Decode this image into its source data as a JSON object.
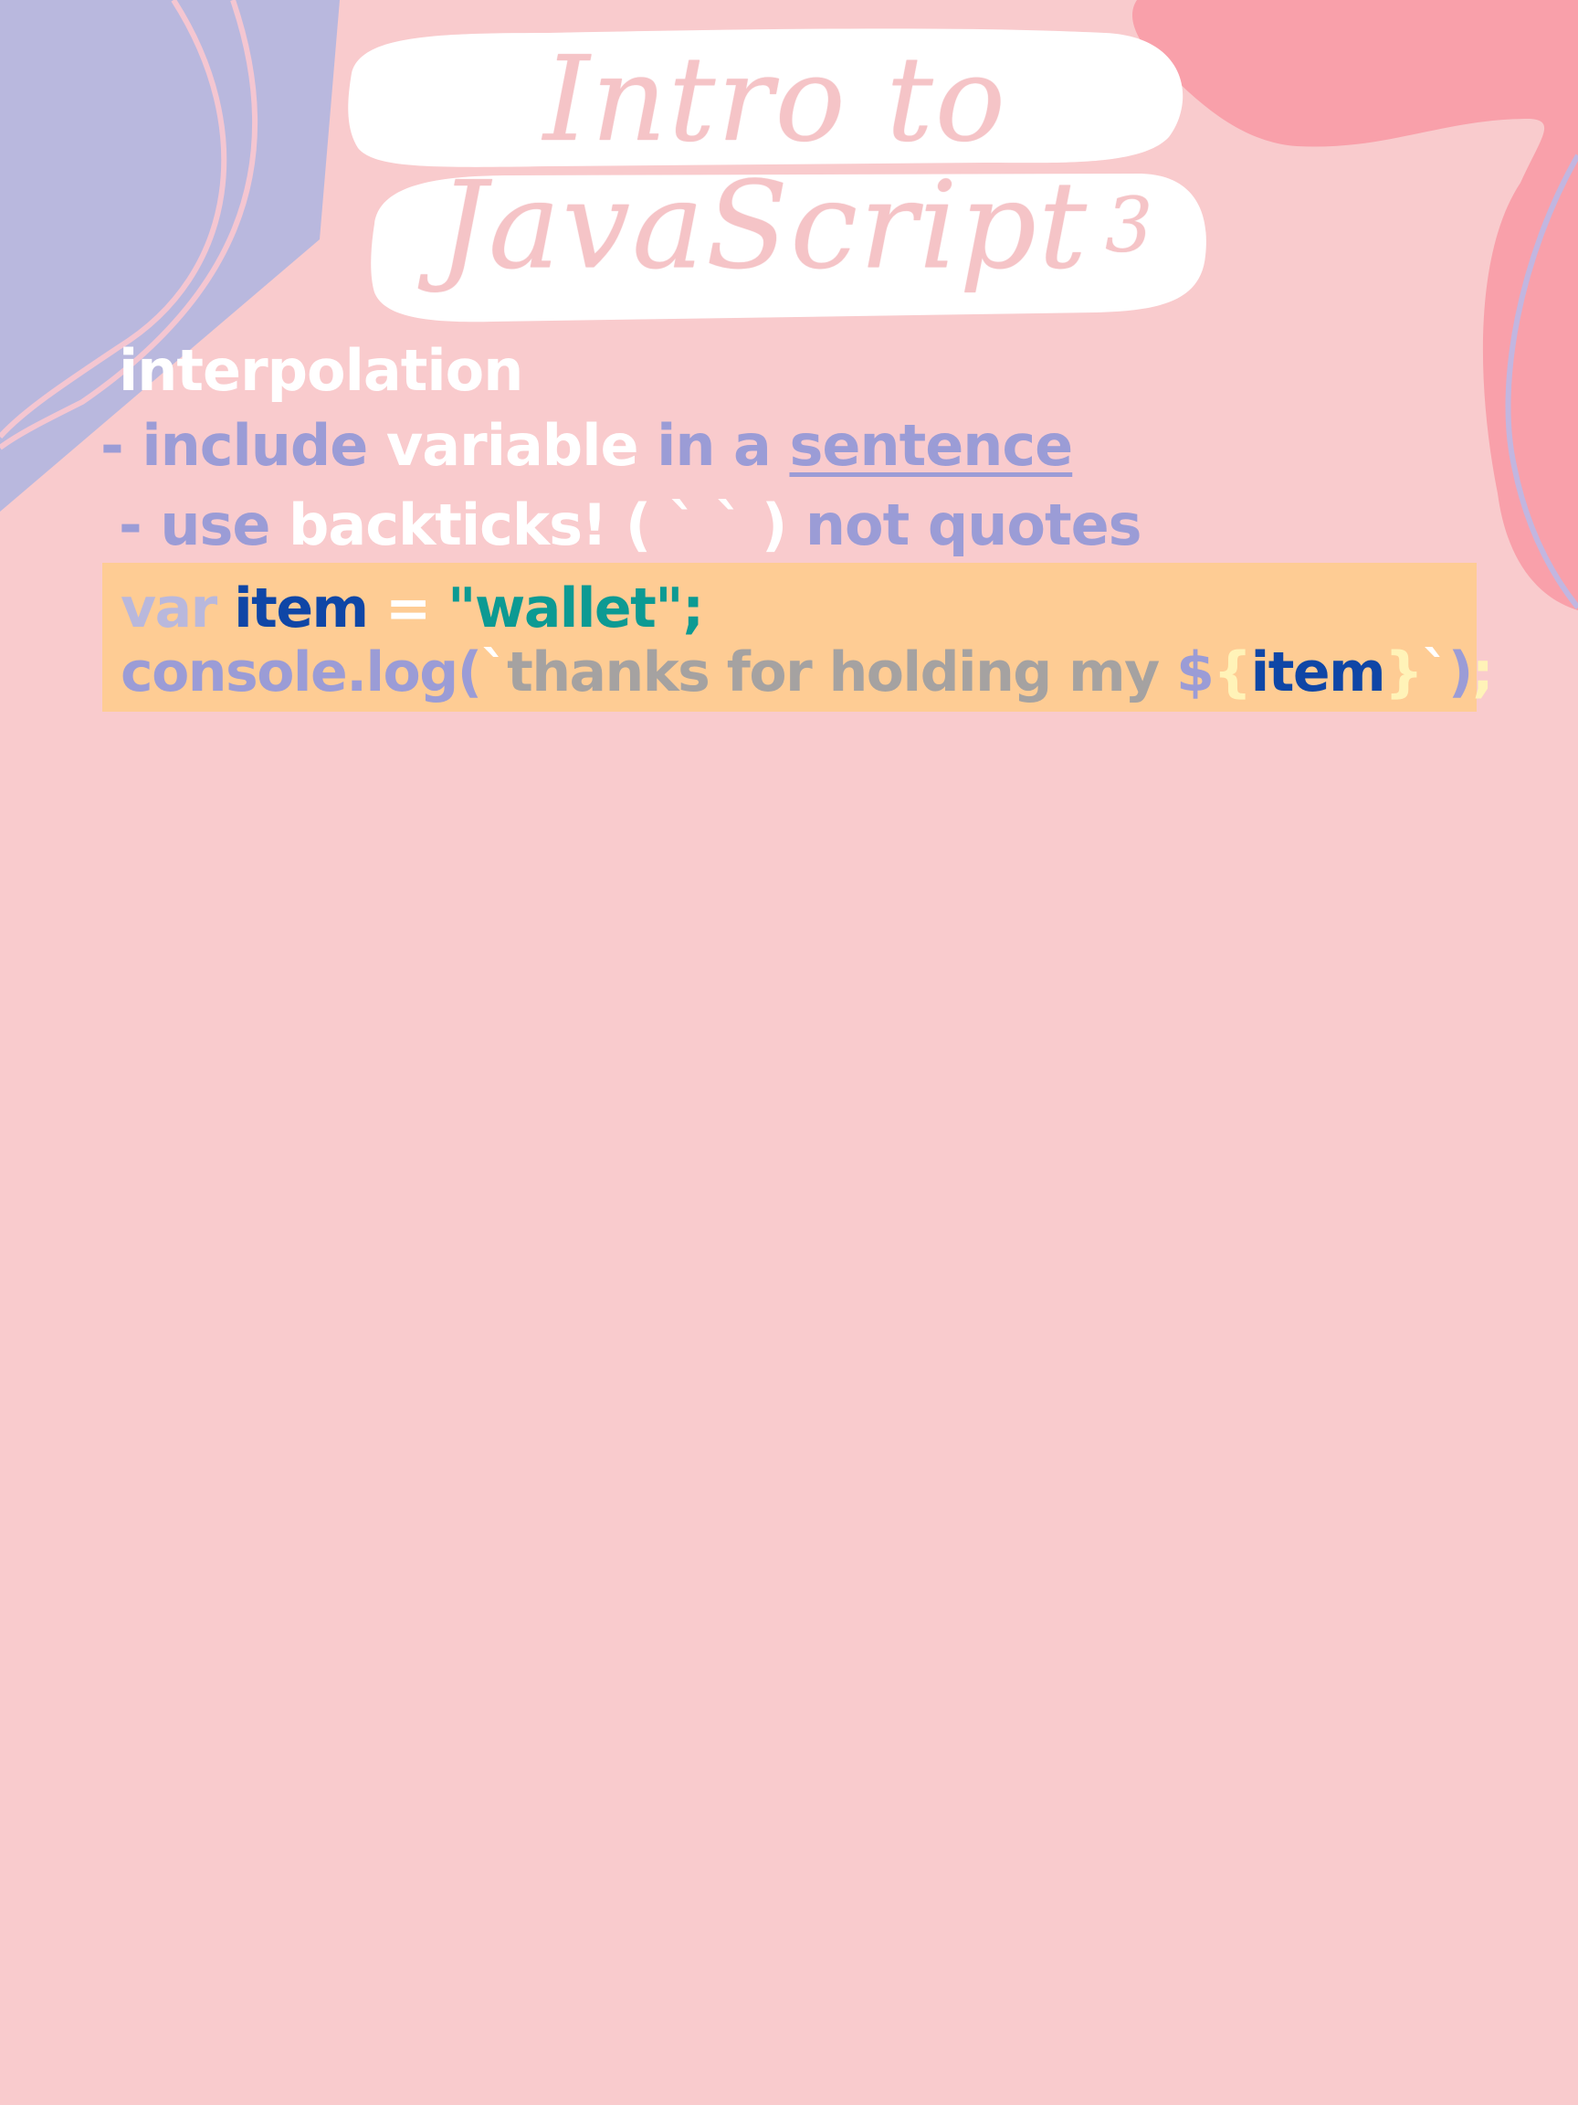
{
  "title": {
    "line1": "Intro to",
    "line2": "JavaScript",
    "number": "3"
  },
  "heading": "interpolation",
  "bullets": [
    {
      "dash": "- ",
      "part1": "include ",
      "part2": "variable ",
      "part3": "in a ",
      "part4": "sentence"
    },
    {
      "dash": "- ",
      "part1": "use ",
      "part2": "backticks! ( ` ` ) ",
      "part3": "not quotes"
    }
  ],
  "code": {
    "line1": {
      "keyword": "var",
      "name": "item",
      "equals": "=",
      "string": "\"wallet\"",
      "semicolon": ";"
    },
    "line2": {
      "call": "console.log(",
      "backtick_open": "`",
      "text": "thanks for holding my ",
      "dollar": "$",
      "brace_open": "{",
      "name": "item",
      "brace_close": "}",
      "backtick_close": "`",
      "paren_close": ")",
      "semicolon": ";"
    }
  },
  "colors": {
    "background": "#f9cbcd",
    "lavender_shape": "#b9b8de",
    "pink_shape": "#f9a0aa",
    "title_pill": "#ffffff",
    "title_text": "#f5c4c7",
    "code_background": "#fecc94",
    "purple_text": "#9b9cd6",
    "blue_text": "#0f46a6",
    "teal_text": "#0c9a93",
    "gray_text": "#a5a2a1"
  }
}
